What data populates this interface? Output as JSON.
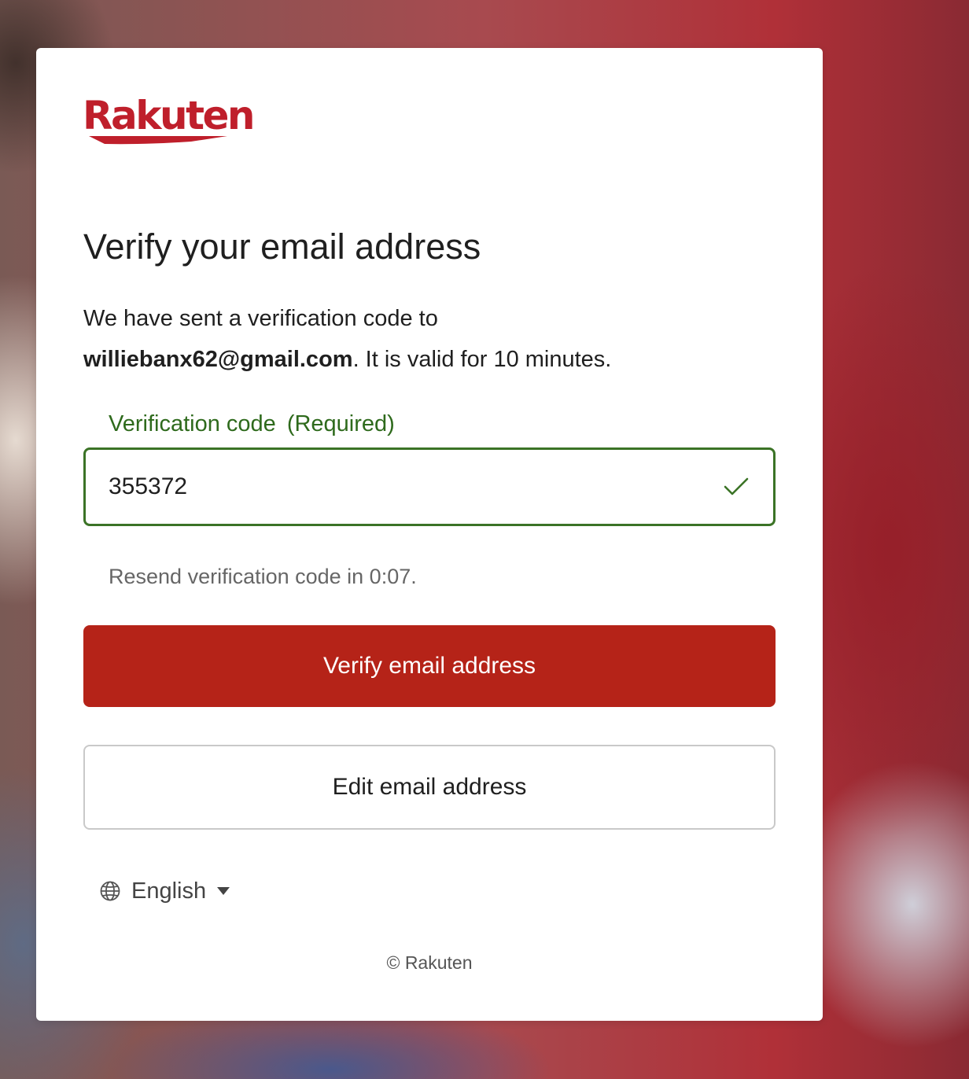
{
  "brand": {
    "logo_text": "Rakuten",
    "color": "#bf1f2b"
  },
  "page": {
    "title": "Verify your email address",
    "description_prefix": "We have sent a verification code to",
    "email": "williebanx62@gmail.com",
    "description_suffix": ". It is valid for 10 minutes."
  },
  "verification_field": {
    "label": "Verification code",
    "required_label": "(Required)",
    "value": "355372",
    "status_icon": "check-icon",
    "accent_color": "#3b7326"
  },
  "resend": {
    "text": "Resend verification code in 0:07."
  },
  "buttons": {
    "verify_label": "Verify email address",
    "verify_color": "#b52318",
    "edit_label": "Edit email address"
  },
  "language": {
    "icon": "globe-icon",
    "selected": "English",
    "dropdown_icon": "caret-down-icon"
  },
  "footer": {
    "copyright": "© Rakuten"
  }
}
